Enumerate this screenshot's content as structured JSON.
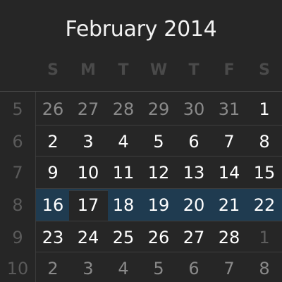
{
  "title": "February 2014",
  "days_of_week": [
    "S",
    "M",
    "T",
    "W",
    "T",
    "F",
    "S"
  ],
  "weeks": [
    {
      "week": "5",
      "days": [
        "26",
        "27",
        "28",
        "29",
        "30",
        "31",
        "1"
      ],
      "style": [
        "muted",
        "muted",
        "muted",
        "muted",
        "muted",
        "muted",
        "current"
      ]
    },
    {
      "week": "6",
      "days": [
        "2",
        "3",
        "4",
        "5",
        "6",
        "7",
        "8"
      ],
      "style": [
        "current",
        "current",
        "current",
        "current",
        "current",
        "current",
        "current"
      ]
    },
    {
      "week": "7",
      "days": [
        "9",
        "10",
        "11",
        "12",
        "13",
        "14",
        "15"
      ],
      "style": [
        "current",
        "current",
        "current",
        "current",
        "current",
        "current",
        "current"
      ]
    },
    {
      "week": "8",
      "days": [
        "16",
        "17",
        "18",
        "19",
        "20",
        "21",
        "22"
      ],
      "style": [
        "current",
        "current",
        "current",
        "current",
        "current",
        "current",
        "current"
      ]
    },
    {
      "week": "9",
      "days": [
        "23",
        "24",
        "25",
        "26",
        "27",
        "28",
        "1"
      ],
      "style": [
        "current",
        "current",
        "current",
        "current",
        "current",
        "current",
        "faint"
      ]
    },
    {
      "week": "10",
      "days": [
        "2",
        "3",
        "4",
        "5",
        "6",
        "7",
        "8"
      ],
      "style": [
        "muted",
        "muted",
        "muted",
        "muted",
        "muted",
        "muted",
        "muted"
      ]
    }
  ],
  "selected_week": "8",
  "today": "17",
  "colors": {
    "background": "#262626",
    "selected_week": "#1f3b50",
    "day_text": "#ffffff",
    "other_month_text": "#8a8a8a",
    "week_number_text": "#5a5a5a",
    "header_text": "#4a4a4a"
  }
}
